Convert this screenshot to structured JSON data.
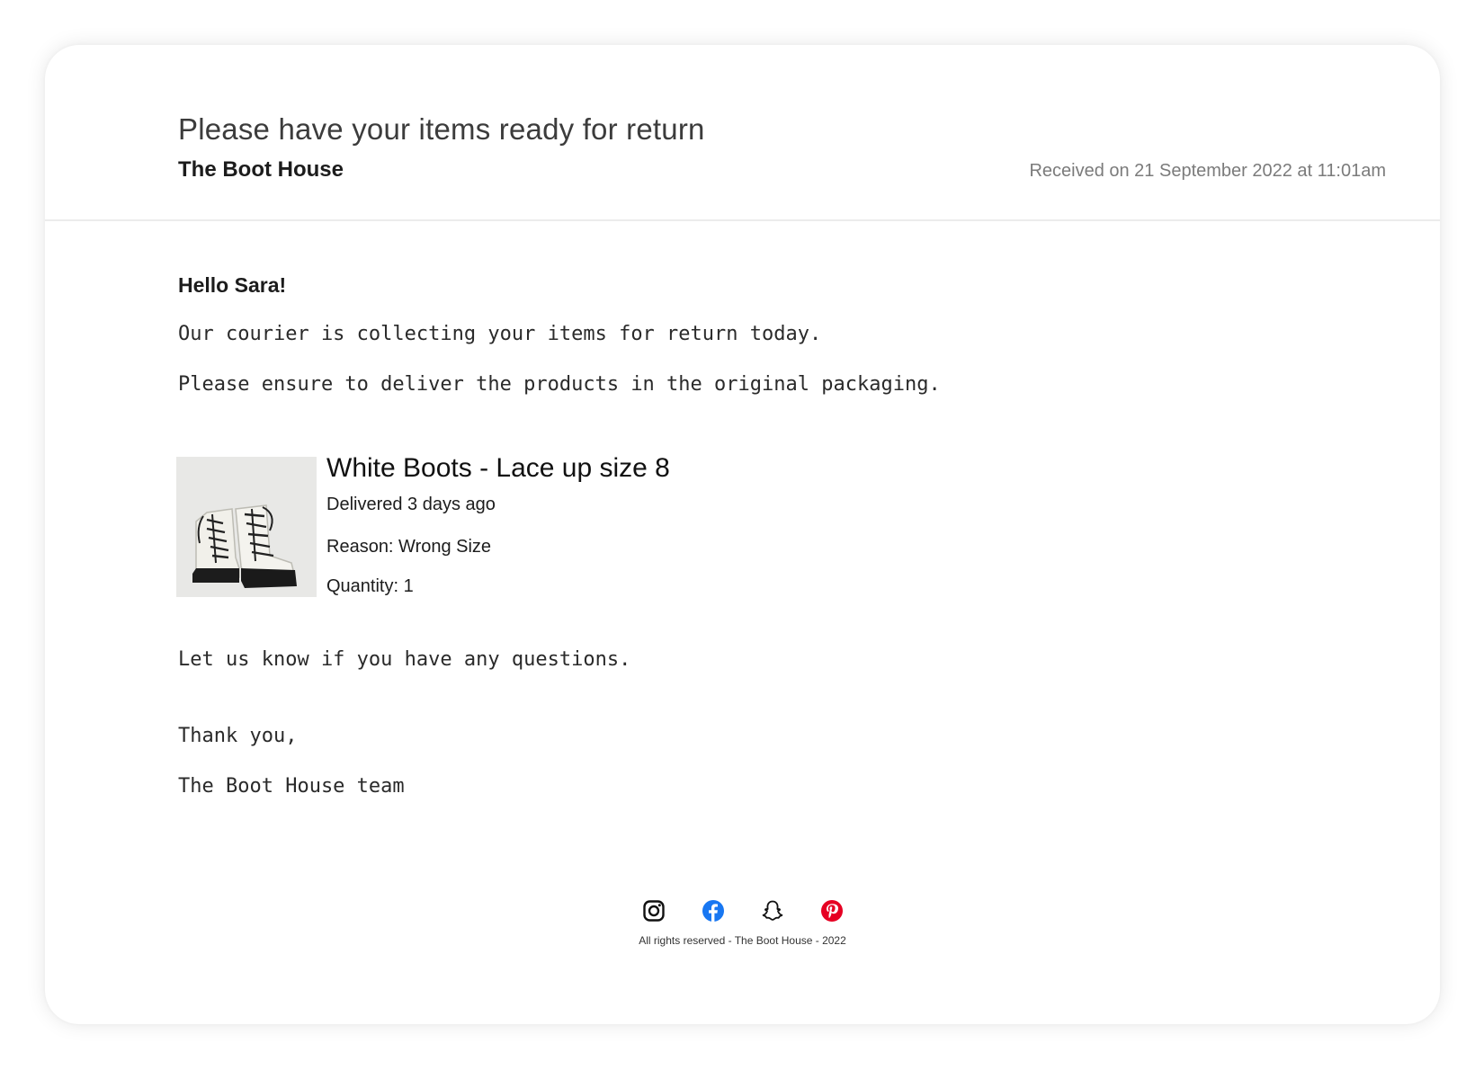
{
  "header": {
    "subject": "Please have your items ready for return",
    "sender": "The Boot House",
    "received": "Received on 21 September 2022 at 11:01am"
  },
  "message": {
    "greeting": "Hello Sara!",
    "line1": "Our courier is collecting your items for return today.",
    "line2": "Please ensure to deliver the products in the original packaging.",
    "closing": "Let us know if you have any questions.",
    "thanks": "Thank you,",
    "signature": "The Boot House team"
  },
  "product": {
    "title": "White Boots - Lace up size 8",
    "delivered": "Delivered 3 days ago",
    "reason": "Reason: Wrong Size",
    "quantity": "Quantity: 1",
    "image_icon": "white-lace-up-boots-image"
  },
  "footer": {
    "socials": [
      {
        "name": "instagram-icon",
        "color": "#111111"
      },
      {
        "name": "facebook-icon",
        "color": "#1877F2"
      },
      {
        "name": "snapchat-icon",
        "color": "#111111"
      },
      {
        "name": "pinterest-icon",
        "color": "#E60023"
      }
    ],
    "copyright": "All rights reserved - The Boot House - 2022"
  }
}
